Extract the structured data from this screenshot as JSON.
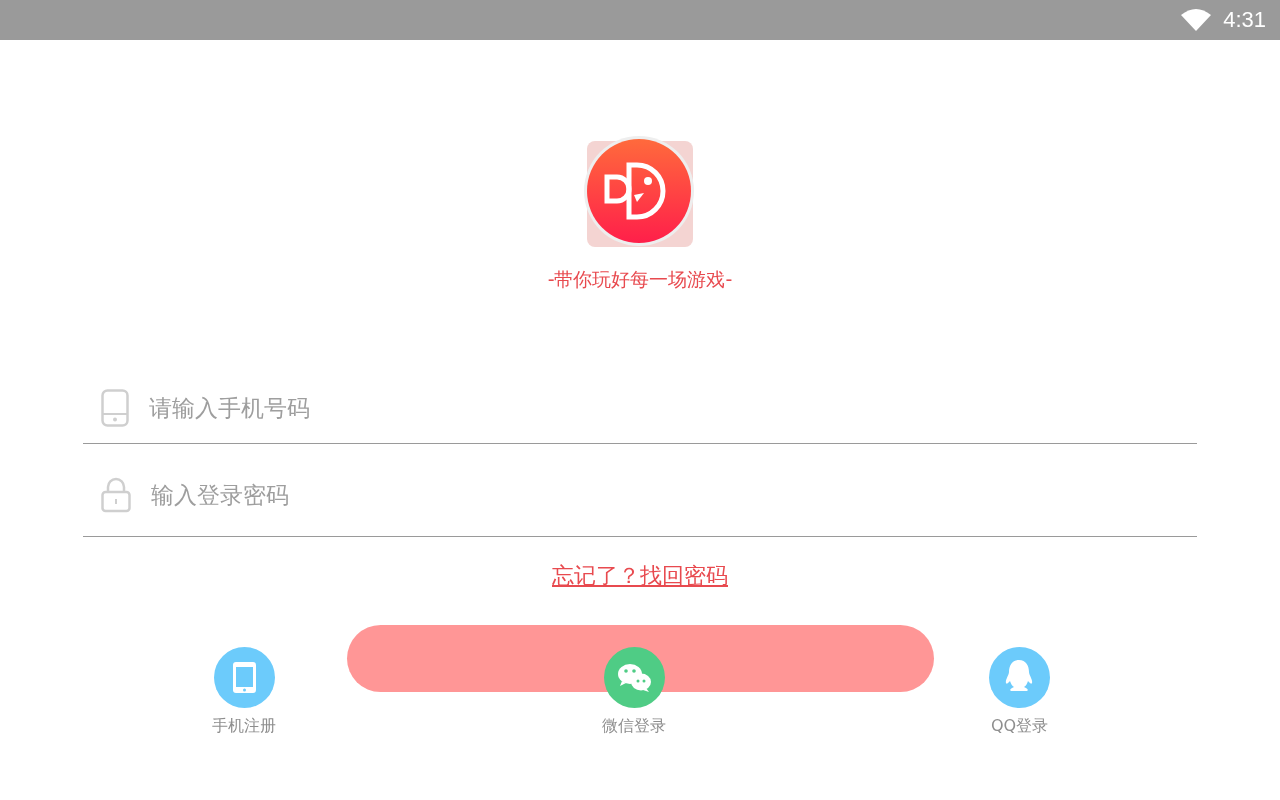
{
  "status_bar": {
    "time": "4:31"
  },
  "slogan": "-带你玩好每一场游戏-",
  "fields": [
    {
      "kind": "phone",
      "placeholder": "请输入手机号码"
    },
    {
      "kind": "password",
      "placeholder": "输入登录密码"
    }
  ],
  "forgot_link": "忘记了？找回密码",
  "social_logins": [
    {
      "kind": "phone",
      "label": "手机注册",
      "color": "#6ccbfb"
    },
    {
      "kind": "wechat",
      "label": "微信登录",
      "color": "#4fcc85"
    },
    {
      "kind": "qq",
      "label": "QQ登录",
      "color": "#6ccbfb"
    }
  ]
}
